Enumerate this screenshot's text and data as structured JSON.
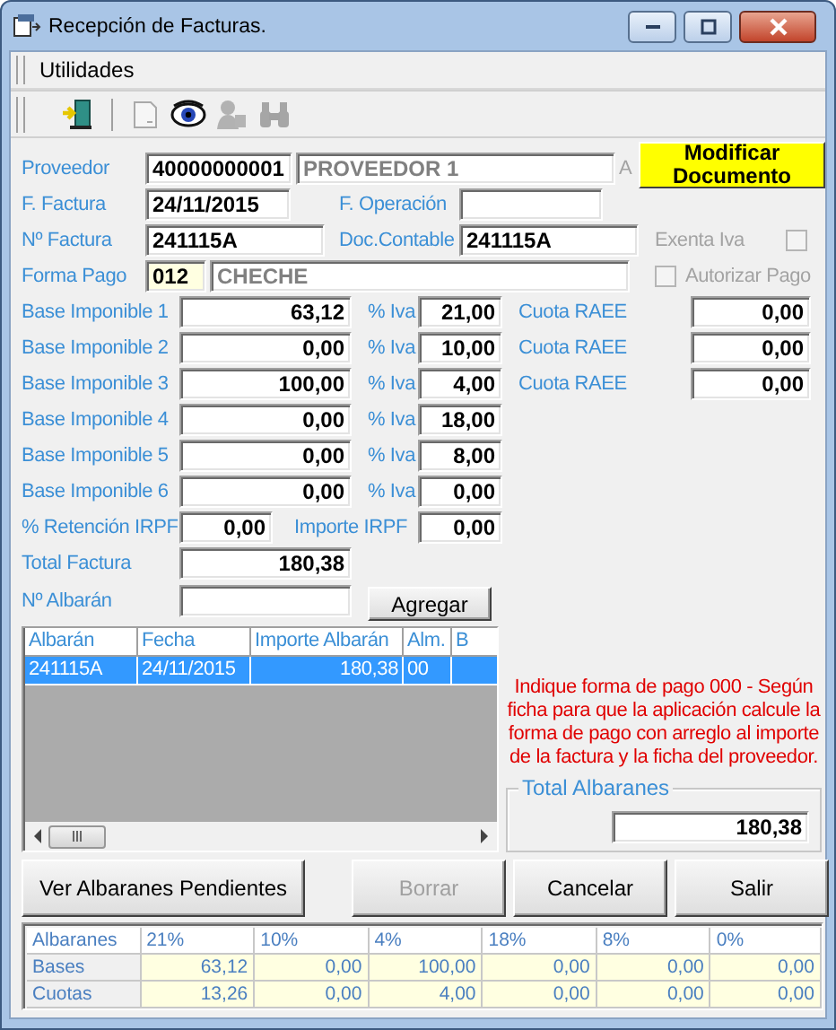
{
  "window": {
    "title": "Recepción de Facturas."
  },
  "menu": [
    {
      "label": "Utilidades"
    }
  ],
  "toolbar": [
    {
      "disabled": false
    },
    {
      "disabled": true
    },
    {
      "disabled": false
    },
    {
      "disabled": true
    },
    {
      "disabled": true
    }
  ],
  "supplier": {
    "label": "Proveedor",
    "code": "40000000001",
    "name": "PROVEEDOR 1",
    "hidden_label": "A"
  },
  "modify_button": {
    "label": "Modificar Documento"
  },
  "invoice_date": {
    "label": "F. Factura",
    "value": "24/11/2015"
  },
  "operation_date": {
    "label": "F. Operación"
  },
  "invoice_number": {
    "label": "Nº Factura",
    "value": "241115A"
  },
  "accounting_doc": {
    "label": "Doc.Contable",
    "value": "241115A"
  },
  "vat_exempt": {
    "label": "Exenta Iva",
    "checked": false,
    "disabled": true
  },
  "payment": {
    "label": "Forma Pago",
    "code": "012",
    "name": "CHECHE"
  },
  "authorize_payment": {
    "label": "Autorizar Pago",
    "checked": false,
    "disabled": true
  },
  "bases": [
    {
      "label": "Base Imponible 1",
      "value": "63,12",
      "vat_label": "% Iva",
      "vat": "21,00",
      "raee_label": "Cuota RAEE",
      "raee": "0,00"
    },
    {
      "label": "Base Imponible 2",
      "value": "0,00",
      "vat_label": "% Iva",
      "vat": "10,00",
      "raee_label": "Cuota RAEE",
      "raee": "0,00"
    },
    {
      "label": "Base Imponible 3",
      "value": "100,00",
      "vat_label": "% Iva",
      "vat": "4,00",
      "raee_label": "Cuota RAEE",
      "raee": "0,00"
    },
    {
      "label": "Base Imponible 4",
      "value": "0,00",
      "vat_label": "% Iva",
      "vat": "18,00"
    },
    {
      "label": "Base Imponible 5",
      "value": "0,00",
      "vat_label": "% Iva",
      "vat": "8,00"
    },
    {
      "label": "Base Imponible 6",
      "value": "0,00",
      "vat_label": "% Iva",
      "vat": "0,00"
    }
  ],
  "irpf": {
    "label": "% Retención IRPF",
    "value": "0,00",
    "amount_label": "Importe IRPF",
    "amount": "0,00"
  },
  "total": {
    "label": "Total Factura",
    "value": "180,38"
  },
  "delivery_note": {
    "label": "Nº Albarán",
    "button": "Agregar"
  },
  "grid": {
    "columns": [
      "Albarán",
      "Fecha",
      "Importe Albarán",
      "Alm.",
      "B"
    ],
    "rows": [
      {
        "cells": [
          "241115A",
          "24/11/2015",
          "180,38",
          "00"
        ],
        "selected": true
      }
    ]
  },
  "notice": "Indique forma de pago 000 - Según ficha  para que la aplicación calcule la forma de pago con arreglo al importe de la factura y la ficha del proveedor.",
  "total_notes": {
    "label": "Total Albaranes",
    "value": "180,38"
  },
  "buttons": [
    {
      "label": "Ver Albaranes Pendientes",
      "disabled": false
    },
    {
      "label": "Borrar",
      "disabled": true
    },
    {
      "label": "Cancelar",
      "disabled": false
    },
    {
      "label": "Salir",
      "disabled": false
    }
  ],
  "summary": {
    "columns": [
      "Albaranes",
      "21%",
      "10%",
      "4%",
      "18%",
      "8%",
      "0%"
    ],
    "rows": [
      {
        "label": "Bases",
        "cells": [
          "63,12",
          "0,00",
          "100,00",
          "0,00",
          "0,00",
          "0,00"
        ]
      },
      {
        "label": "Cuotas",
        "cells": [
          "13,26",
          "0,00",
          "4,00",
          "0,00",
          "0,00",
          "0,00"
        ]
      }
    ]
  }
}
